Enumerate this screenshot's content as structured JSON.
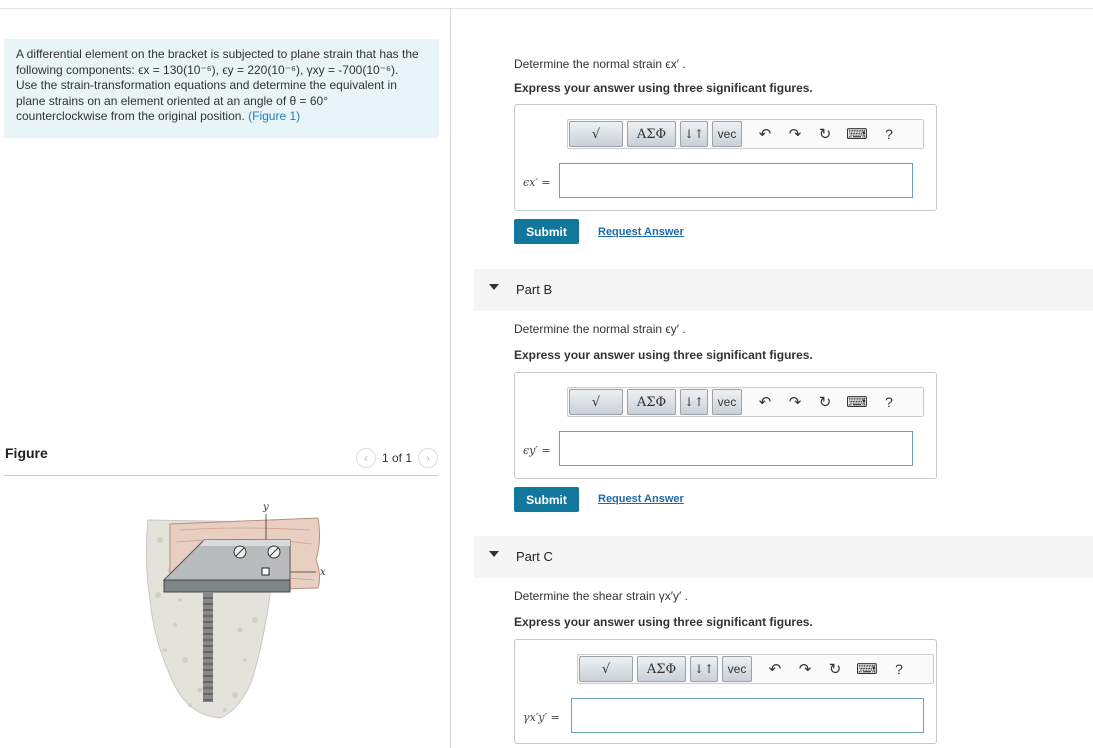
{
  "problem": {
    "line1": "A differential element on the bracket is subjected to plane strain that has the",
    "line2": "following components: ϵx = 130(10⁻⁶), ϵy = 220(10⁻⁶), γxy = -700(10⁻⁶).",
    "line3": "Use the strain-transformation equations and determine the equivalent in",
    "line4": "plane strains on an element oriented at an angle of θ = 60°",
    "line5": "counterclockwise from the original position.",
    "figure_link": "(Figure 1)"
  },
  "figure": {
    "title": "Figure",
    "pager": "1 of 1",
    "prev_icon": "chevron-left-icon",
    "next_icon": "chevron-right-icon",
    "axis_y": "y",
    "axis_x": "x"
  },
  "toolbar": {
    "templates": "√",
    "greek": "ΑΣΦ",
    "arrows": "↓↑",
    "vec": "vec",
    "undo": "↶",
    "redo": "↷",
    "reset": "↻",
    "keyboard": "⌨",
    "help": "?"
  },
  "partA": {
    "question": "Determine the normal strain ϵx′ .",
    "instruction": "Express your answer using three significant figures.",
    "label": "ϵx′ =",
    "input_value": "",
    "submit": "Submit",
    "request": "Request Answer"
  },
  "partB": {
    "title": "Part B",
    "question": "Determine the normal strain ϵy′ .",
    "instruction": "Express your answer using three significant figures.",
    "label": "ϵy′ =",
    "input_value": "",
    "submit": "Submit",
    "request": "Request Answer"
  },
  "partC": {
    "title": "Part C",
    "question": "Determine the shear strain γx′y′ .",
    "instruction": "Express your answer using three significant figures.",
    "label": "γx′y′ =",
    "input_value": ""
  },
  "colors": {
    "accent": "#12779c",
    "link": "#1e7fb8",
    "problem_bg": "#e8f4f8"
  }
}
